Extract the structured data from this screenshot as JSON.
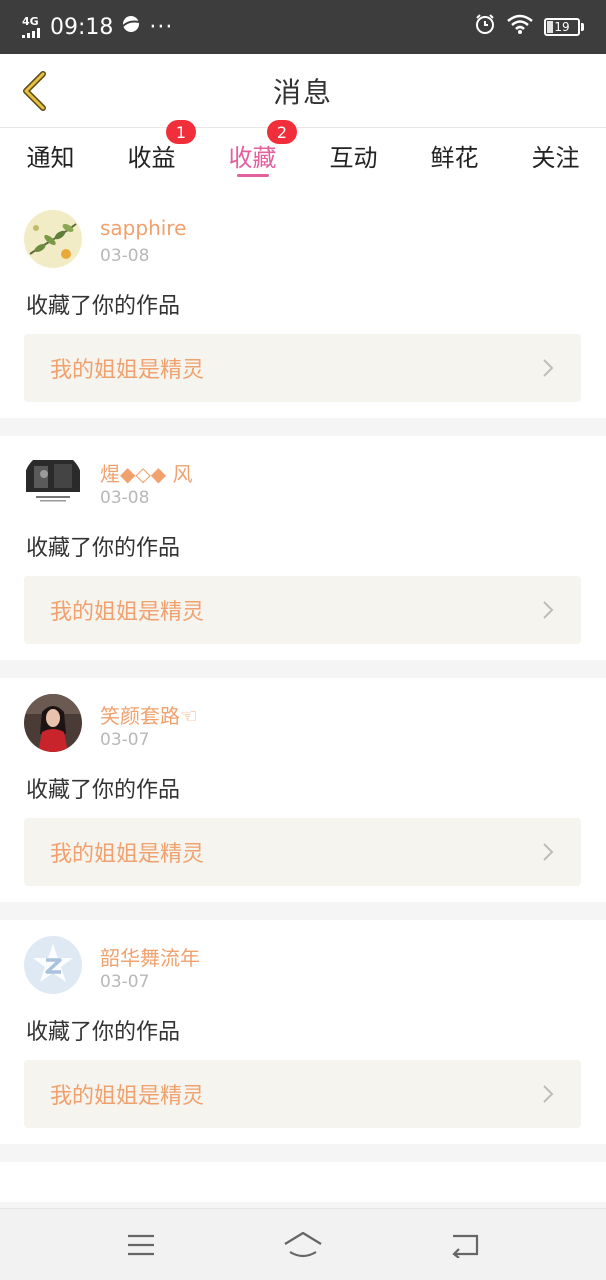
{
  "status_bar": {
    "network": "4G",
    "time": "09:18",
    "battery": "19",
    "icons": [
      "signal-icon",
      "browser-icon",
      "more-dots-icon",
      "alarm-icon",
      "wifi-icon",
      "battery-icon"
    ],
    "dots": "···"
  },
  "header": {
    "title": "消息",
    "back_icon": "chevron-left-icon"
  },
  "tabs": [
    {
      "label": "通知"
    },
    {
      "label": "收益",
      "badge": "1"
    },
    {
      "label": "收藏",
      "badge": "2"
    },
    {
      "label": "互动"
    },
    {
      "label": "鲜花"
    },
    {
      "label": "关注"
    }
  ],
  "active_tab": "收藏",
  "messages": [
    {
      "user": "sapphire",
      "date": "03-08",
      "action": "收藏了你的作品",
      "work": "我的姐姐是精灵",
      "avatar": "plant-illustration-avatar"
    },
    {
      "user": "煋◆◇◆ 风",
      "date": "03-08",
      "action": "收藏了你的作品",
      "work": "我的姐姐是精灵",
      "avatar": "dark-photo-avatar"
    },
    {
      "user": "笑颜套路☜",
      "date": "03-07",
      "action": "收藏了你的作品",
      "work": "我的姐姐是精灵",
      "avatar": "girl-red-dress-avatar"
    },
    {
      "user": "韶华舞流年",
      "date": "03-07",
      "action": "收藏了你的作品",
      "work": "我的姐姐是精灵",
      "avatar": "default-z-avatar"
    }
  ],
  "colors": {
    "accent_pink": "#e2609e",
    "username_orange": "#f0a16e",
    "badge_red": "#f02f3a",
    "back_arrow_yellow": "#e8c23a",
    "work_bg": "#f5f4ee"
  },
  "nav": {
    "icons": [
      "menu-icon",
      "home-icon",
      "back-icon"
    ]
  }
}
